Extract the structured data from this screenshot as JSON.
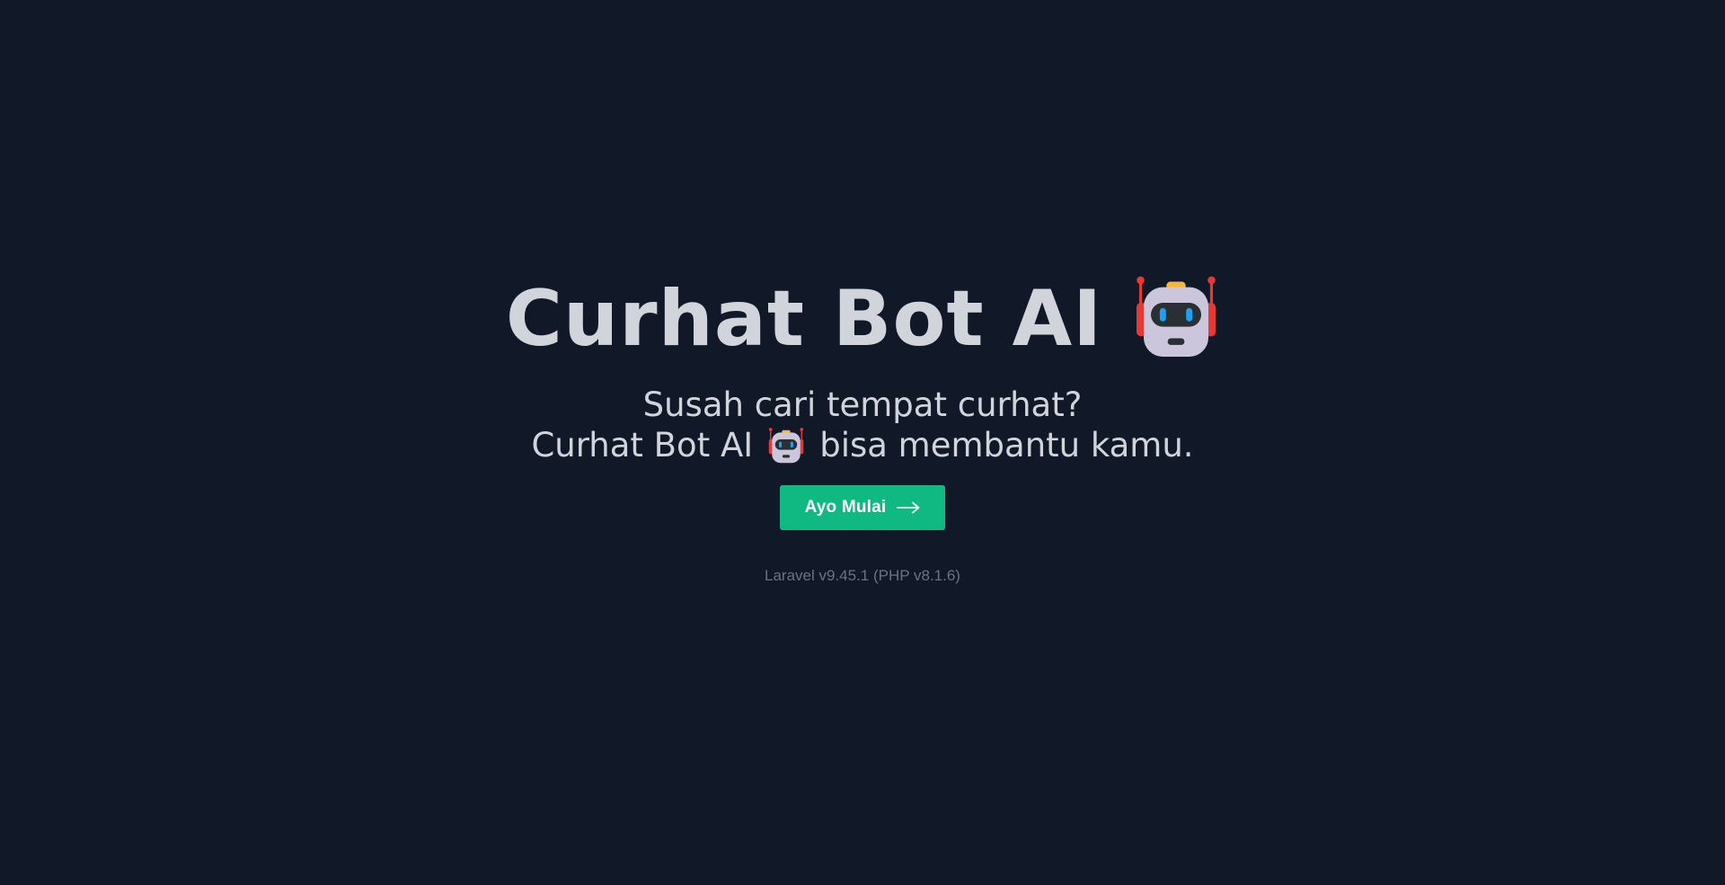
{
  "hero": {
    "title": "Curhat Bot AI",
    "title_icon": "robot-icon",
    "subtitle_line1": "Susah cari tempat curhat?",
    "subtitle_line2_prefix": "Curhat Bot AI",
    "subtitle_line2_icon": "robot-icon",
    "subtitle_line2_suffix": "bisa membantu kamu."
  },
  "cta": {
    "label": "Ayo Mulai",
    "icon": "arrow-right-icon",
    "color": "#10b981"
  },
  "footer": {
    "version": "Laravel v9.45.1 (PHP v8.1.6)"
  },
  "colors": {
    "background": "#111827",
    "text": "#d1d5db",
    "muted": "#6b7280"
  }
}
